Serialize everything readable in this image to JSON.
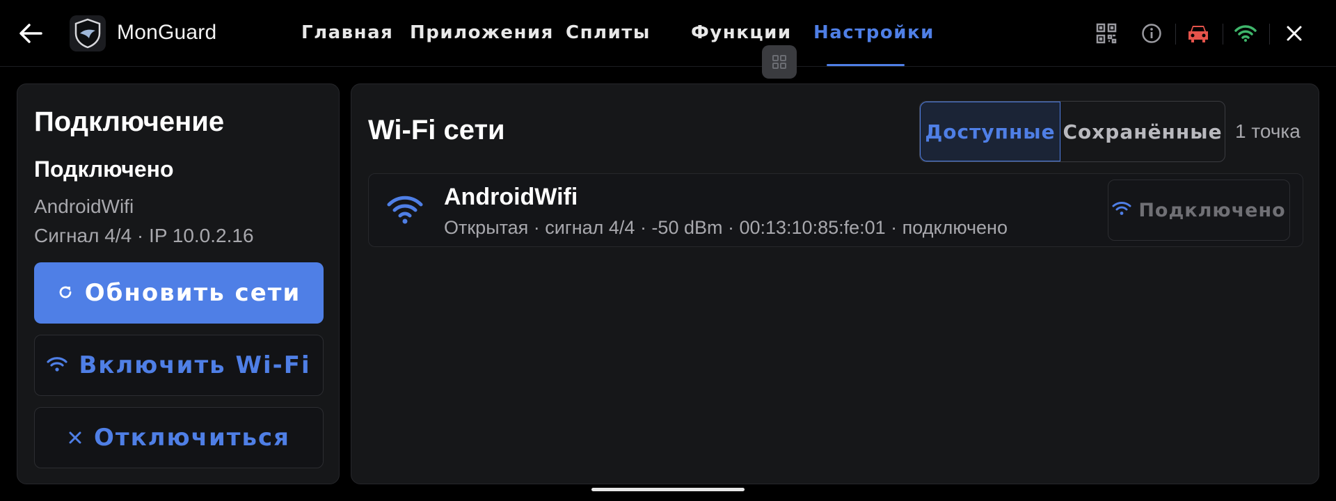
{
  "header": {
    "app_name": "MonGuard",
    "nav": [
      {
        "label": "Главная"
      },
      {
        "label": "Приложения"
      },
      {
        "label": "Сплиты"
      },
      {
        "label": "Функции"
      },
      {
        "label": "Настройки",
        "active": true
      }
    ],
    "icons": [
      "back-arrow-icon",
      "shield-logo-icon",
      "qr-code-icon",
      "info-icon",
      "car-icon",
      "wifi-status-icon",
      "close-icon",
      "grid-handle-icon"
    ],
    "colors": {
      "accent": "#4f7fe6",
      "car": "#e5534b",
      "wifi_ok": "#3fb66b"
    }
  },
  "connection": {
    "title": "Подключение",
    "status": "Подключено",
    "ssid": "AndroidWifi",
    "signal_line": "Сигнал 4/4 · IP 10.0.2.16",
    "buttons": {
      "refresh": "Обновить сети",
      "enable_wifi": "Включить Wi-Fi",
      "disconnect": "Отключиться"
    }
  },
  "networks": {
    "title": "Wi-Fi сети",
    "tabs": {
      "available": "Доступные",
      "saved": "Сохранённые",
      "selected": "available"
    },
    "count_label": "1 точка",
    "items": [
      {
        "name": "AndroidWifi",
        "details": "Открытая · сигнал 4/4 · -50 dBm · 00:13:10:85:fe:01 · подключено",
        "badge": "Подключено"
      }
    ]
  }
}
